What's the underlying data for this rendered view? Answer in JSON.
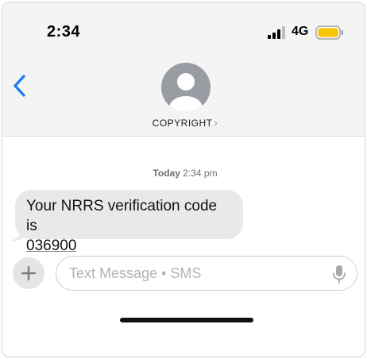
{
  "status_bar": {
    "time": "2:34",
    "network": "4G",
    "battery_color": "#f7c600",
    "signal_icon": "signal-bars-icon",
    "battery_icon": "battery-icon"
  },
  "header": {
    "back_icon": "chevron-left-icon",
    "avatar_icon": "person-avatar-icon",
    "contact_name": "COPYRIGHT",
    "contact_chevron": "›",
    "accent_color": "#1a7cf4"
  },
  "thread": {
    "timestamp_day": "Today",
    "timestamp_time": "2:34 pm",
    "messages": [
      {
        "direction": "incoming",
        "text": "Your NRRS verification code is",
        "code": "036900",
        "bubble_color": "#e9e9eb"
      }
    ]
  },
  "composer": {
    "plus_icon": "plus-icon",
    "placeholder": "Text Message • SMS",
    "mic_icon": "microphone-icon"
  }
}
